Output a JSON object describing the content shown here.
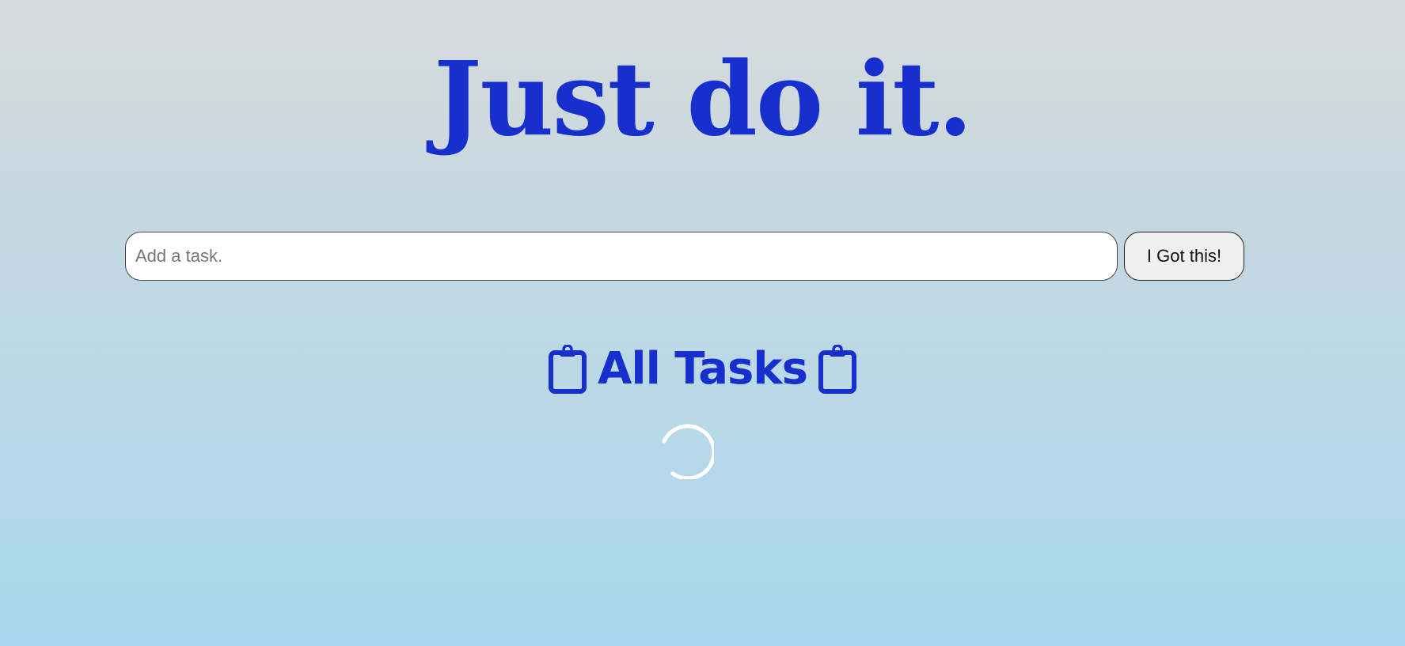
{
  "header": {
    "title": "Just do it."
  },
  "task_form": {
    "input_value": "",
    "input_placeholder": "Add a task.",
    "submit_label": "I Got this!"
  },
  "tasks_section": {
    "heading": "All Tasks",
    "heading_icon": "clipboard-icon",
    "status": "loading"
  },
  "colors": {
    "accent": "#172fcd",
    "spinner": "#ffffff",
    "background_top": "#d6dadb",
    "background_bottom": "#a9d8ee"
  }
}
